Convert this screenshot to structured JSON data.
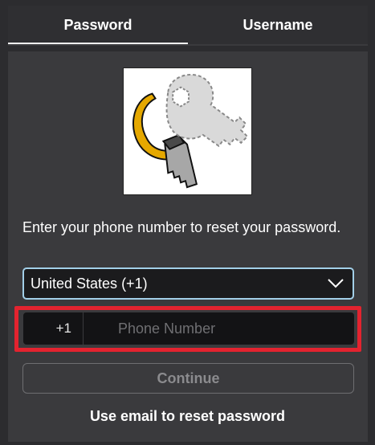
{
  "tabs": [
    {
      "label": "Password",
      "active": true
    },
    {
      "label": "Username",
      "active": false
    }
  ],
  "hero": {
    "icon": "key-icon"
  },
  "instruction": "Enter your phone number to reset your password.",
  "country_select": {
    "value": "United States (+1)"
  },
  "phone": {
    "prefix": "+1",
    "placeholder": "Phone Number",
    "value": ""
  },
  "continue_label": "Continue",
  "email_link": "Use email to reset password",
  "colors": {
    "background": "#2c2c2f",
    "panel": "#3a3a3d",
    "select_border": "#a2cfe8",
    "highlight": "#e3232f",
    "key_gold": "#e5a800",
    "key_gray": "#d9d9d9"
  }
}
